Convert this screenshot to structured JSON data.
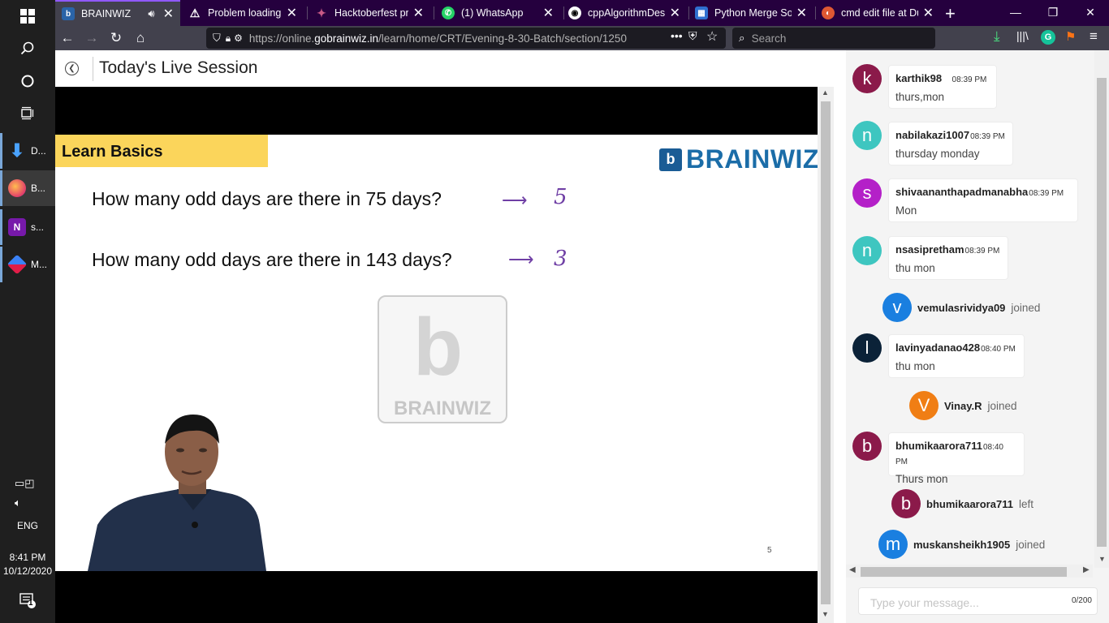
{
  "taskbar": {
    "apps": [
      {
        "label": "D...",
        "icon": "download-arrow-icon"
      },
      {
        "label": "B...",
        "icon": "firefox-icon"
      },
      {
        "label": "s...",
        "icon": "onenote-icon"
      },
      {
        "label": "M...",
        "icon": "git-icon"
      }
    ],
    "language": "ENG",
    "time": "8:41 PM",
    "date": "10/12/2020",
    "notification_count": "1"
  },
  "browser": {
    "tabs": [
      {
        "title": "BRAINWIZ",
        "active": true,
        "favicon_letter": "b",
        "favicon_color": "#2a64a8"
      },
      {
        "title": "Problem loading page",
        "active": false,
        "favicon_letter": "!",
        "favicon_color": "#ffffff"
      },
      {
        "title": "Hacktoberfest presents",
        "active": false,
        "favicon_letter": "✦",
        "favicon_color": "#9c4668"
      },
      {
        "title": "(1) WhatsApp",
        "active": false,
        "favicon_letter": "✆",
        "favicon_color": "#25d366"
      },
      {
        "title": "cppAlgorithmDesign",
        "active": false,
        "favicon_letter": "◉",
        "favicon_color": "#ffffff"
      },
      {
        "title": "Python Merge Sort",
        "active": false,
        "favicon_letter": "▦",
        "favicon_color": "#2f6fd0"
      },
      {
        "title": "cmd edit file at Duck",
        "active": false,
        "favicon_letter": "◐",
        "favicon_color": "#de5833"
      }
    ],
    "url_prefix": "https://online.",
    "url_host": "gobrainwiz.in",
    "url_path": "/learn/home/CRT/Evening-8-30-Batch/section/1250",
    "search_placeholder": "Search"
  },
  "page": {
    "title": "Today's Live Session",
    "slide": {
      "badge": "Learn Basics",
      "logo_text": "BRAINWIZ",
      "watermark_text": "BRAINWIZ",
      "questions": [
        {
          "text": "How many odd days are there in 75 days?",
          "answer": "5"
        },
        {
          "text": "How many odd days are there in 143 days?",
          "answer": "3"
        }
      ],
      "page_number": "5"
    }
  },
  "chat": {
    "messages": [
      {
        "type": "message",
        "initial": "k",
        "name": "karthik98",
        "time": "08:39 PM",
        "text": "thurs,mon",
        "color": "#8b1a4a"
      },
      {
        "type": "message",
        "initial": "n",
        "name": "nabilakazi1007",
        "time": "08:39 PM",
        "text": "thursday monday",
        "color": "#3ec6c0"
      },
      {
        "type": "message",
        "initial": "s",
        "name": "shivaananthapadmanabha",
        "time": "08:39 PM",
        "text": "Mon",
        "color": "#b420c8"
      },
      {
        "type": "message",
        "initial": "n",
        "name": "nsasipretham",
        "time": "08:39 PM",
        "text": "thu mon",
        "color": "#3ec6c0"
      },
      {
        "type": "event",
        "initial": "v",
        "name": "vemulasrividya09",
        "action": "joined",
        "color": "#1a7fe0"
      },
      {
        "type": "message",
        "initial": "l",
        "name": "lavinyadanao428",
        "time": "08:40 PM",
        "text": "thu mon",
        "color": "#0b2238"
      },
      {
        "type": "event",
        "initial": "V",
        "name": "Vinay.R",
        "action": "joined",
        "color": "#f07e14"
      },
      {
        "type": "message",
        "initial": "b",
        "name": "bhumikaarora711",
        "time": "08:40 PM",
        "text": "Thurs mon",
        "color": "#8b1a4a"
      },
      {
        "type": "event",
        "initial": "b",
        "name": "bhumikaarora711",
        "action": "left",
        "color": "#8b1a4a"
      },
      {
        "type": "event",
        "initial": "m",
        "name": "muskansheikh1905",
        "action": "joined",
        "color": "#1a7fe0"
      }
    ],
    "input_placeholder": "Type your message...",
    "char_count": "0/200"
  }
}
